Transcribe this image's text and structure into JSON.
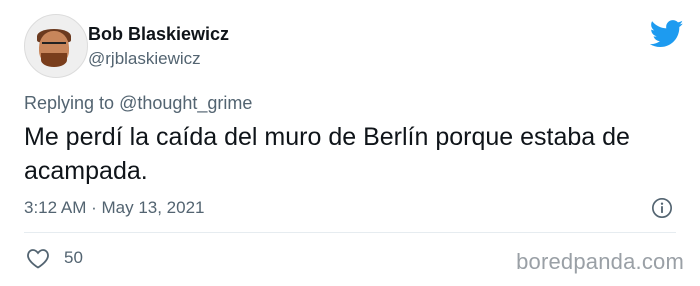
{
  "author": {
    "name": "Bob Blaskiewicz",
    "handle": "@rjblaskiewicz"
  },
  "reply": {
    "prefix": "Replying to",
    "mention": "@thought_grime"
  },
  "tweet": {
    "text": "Me perdí la caída del muro de Berlín porque estaba de acampada.",
    "timestamp": "3:12 AM · May 13, 2021",
    "likes": "50"
  },
  "watermark": "boredpanda.com",
  "colors": {
    "twitter_blue": "#1d9bf0",
    "secondary_text": "#536471"
  }
}
